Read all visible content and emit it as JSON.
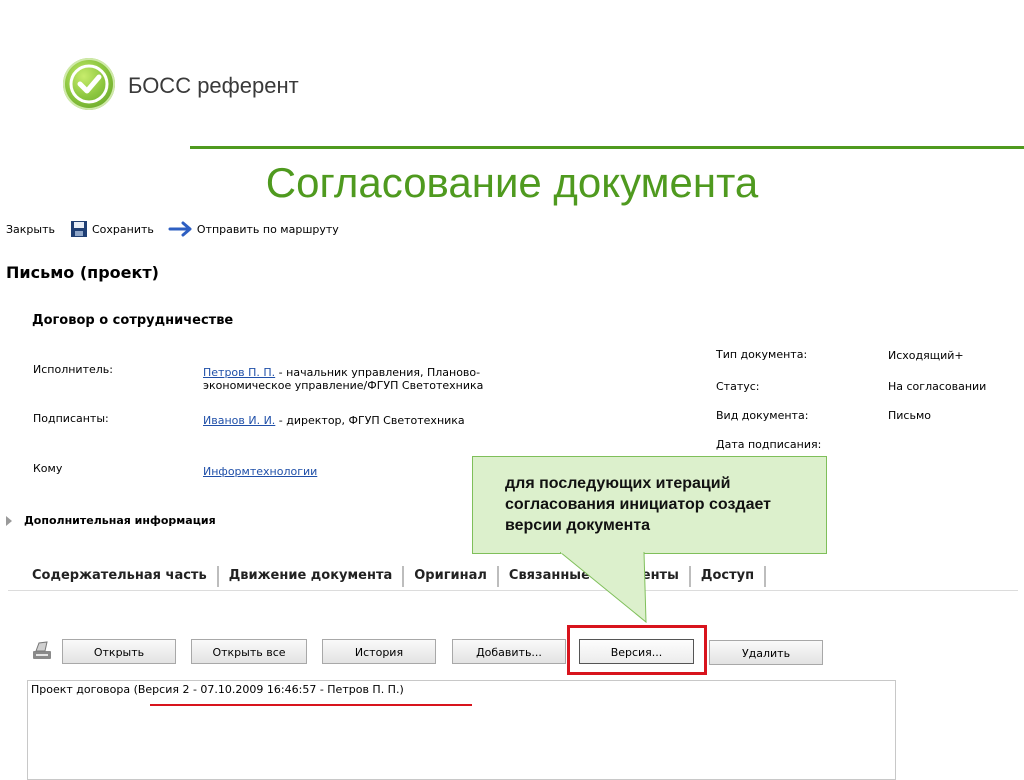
{
  "brand": {
    "name": "БОСС референт"
  },
  "slide": {
    "title": "Согласование документа"
  },
  "toolbar": {
    "close": "Закрыть",
    "save": "Сохранить",
    "send_route": "Отправить по маршруту"
  },
  "document": {
    "heading": "Письмо (проект)",
    "subject": "Договор о сотрудничестве",
    "executor_label": "Исполнитель:",
    "executor_name": "Петров П. П.",
    "executor_desc_line1": " - начальник управления, Планово-",
    "executor_desc_line2": "экономическое управление/ФГУП Светотехника",
    "signers_label": "Подписанты:",
    "signers_name": "Иванов И. И.",
    "signers_desc": " - директор, ФГУП Светотехника",
    "to_label": "Кому",
    "to_value": "Информтехнологии",
    "props": [
      {
        "label": "Тип документа:",
        "value": "Исходящий+"
      },
      {
        "label": "Статус:",
        "value": "На согласовании"
      },
      {
        "label": "Вид документа:",
        "value": "Письмо"
      },
      {
        "label": "Дата подписания:",
        "value": ""
      }
    ],
    "additional_info": "Дополнительная информация"
  },
  "tabs": [
    {
      "label": "Содержательная часть",
      "active": true
    },
    {
      "label": "Движение документа"
    },
    {
      "label": "Оригинал"
    },
    {
      "label": "Связанные документы"
    },
    {
      "label": "Доступ"
    }
  ],
  "buttons": {
    "open": "Открыть",
    "open_all": "Открыть все",
    "history": "История",
    "add": "Добавить...",
    "version": "Версия...",
    "delete": "Удалить"
  },
  "files": [
    "Проект договора (Версия 2 - 07.10.2009 16:46:57 - Петров П. П.)"
  ],
  "callout": {
    "text": "для последующих итераций согласования инициатор создает версии документа"
  },
  "colors": {
    "brand_green": "#4f9a1f",
    "callout_bg": "#dcf0cc",
    "highlight_red": "#d8141d",
    "link_blue": "#1f4fa8"
  }
}
